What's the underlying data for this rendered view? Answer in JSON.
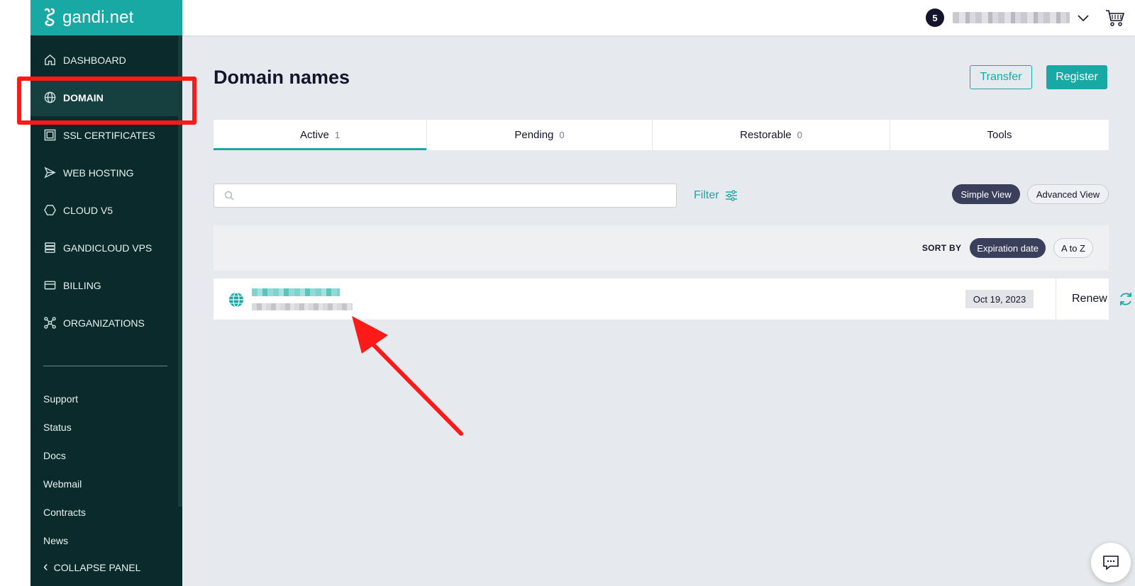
{
  "brand": {
    "logo_text": "gandi.net"
  },
  "sidebar": {
    "items": [
      {
        "label": "DASHBOARD",
        "icon": "home-icon"
      },
      {
        "label": "DOMAIN",
        "icon": "globe-icon",
        "active": true
      },
      {
        "label": "SSL CERTIFICATES",
        "icon": "certificate-icon"
      },
      {
        "label": "WEB HOSTING",
        "icon": "paper-plane-icon"
      },
      {
        "label": "CLOUD V5",
        "icon": "hexagon-icon"
      },
      {
        "label": "GANDICLOUD VPS",
        "icon": "server-icon"
      },
      {
        "label": "BILLING",
        "icon": "credit-card-icon"
      },
      {
        "label": "ORGANIZATIONS",
        "icon": "network-icon"
      }
    ],
    "links": [
      "Support",
      "Status",
      "Docs",
      "Webmail",
      "Contracts",
      "News"
    ],
    "collapse_label": "COLLAPSE PANEL"
  },
  "topbar": {
    "notification_count": "5"
  },
  "page": {
    "title": "Domain names",
    "transfer_label": "Transfer",
    "register_label": "Register"
  },
  "tabs": [
    {
      "label": "Active",
      "count": "1",
      "active": true
    },
    {
      "label": "Pending",
      "count": "0"
    },
    {
      "label": "Restorable",
      "count": "0"
    },
    {
      "label": "Tools",
      "count": ""
    }
  ],
  "search": {
    "placeholder": ""
  },
  "filter_label": "Filter",
  "views": {
    "simple": "Simple View",
    "advanced": "Advanced View"
  },
  "sort": {
    "label": "SORT BY",
    "expiration": "Expiration date",
    "alpha": "A to Z"
  },
  "domain_row": {
    "expiry": "Oct 19, 2023",
    "renew_label": "Renew"
  },
  "colors": {
    "accent": "#18a9a4",
    "sidebar": "#0b2a2b",
    "annotation": "#ff1a1a"
  }
}
